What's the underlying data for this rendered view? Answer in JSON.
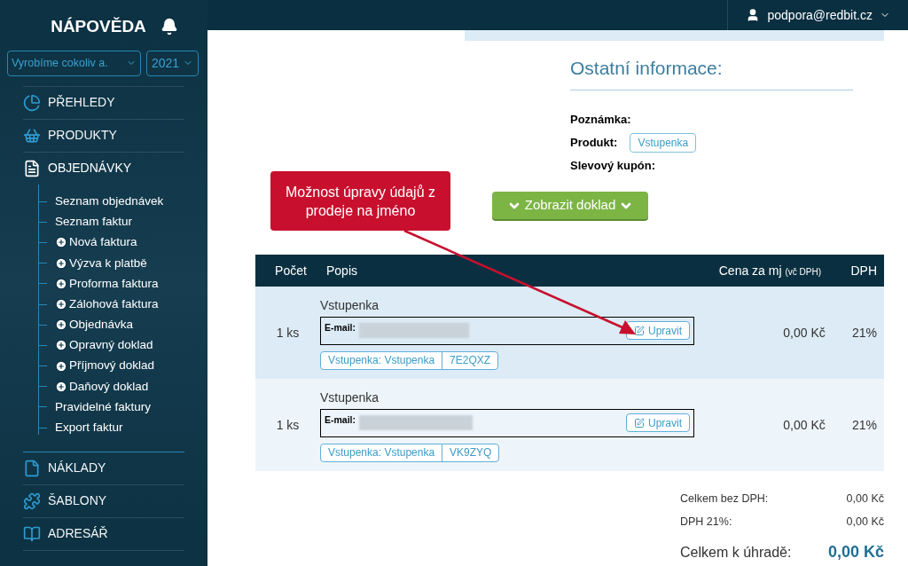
{
  "sidebar": {
    "title": "NÁPOVĚDA",
    "company_select": {
      "value": "Vyrobíme cokoliv a."
    },
    "year_select": {
      "value": "2021"
    },
    "items": [
      {
        "label": "PŘEHLEDY",
        "expanded": false
      },
      {
        "label": "PRODUKTY",
        "expanded": false
      },
      {
        "label": "OBJEDNÁVKY",
        "expanded": true,
        "children": [
          {
            "label": "Seznam objednávek",
            "kind": "link"
          },
          {
            "label": "Seznam faktur",
            "kind": "link"
          },
          {
            "label": "Nová faktura",
            "kind": "create"
          },
          {
            "label": "Výzva k platbě",
            "kind": "create"
          },
          {
            "label": "Proforma faktura",
            "kind": "create"
          },
          {
            "label": "Zálohová faktura",
            "kind": "create"
          },
          {
            "label": "Objednávka",
            "kind": "create"
          },
          {
            "label": "Opravný doklad",
            "kind": "create"
          },
          {
            "label": "Příjmový doklad",
            "kind": "create"
          },
          {
            "label": "Daňový doklad",
            "kind": "create"
          },
          {
            "label": "Pravidelné faktury",
            "kind": "link"
          },
          {
            "label": "Export faktur",
            "kind": "link"
          }
        ]
      },
      {
        "label": "NÁKLADY",
        "expanded": false
      },
      {
        "label": "ŠABLONY",
        "expanded": false
      },
      {
        "label": "ADRESÁŘ",
        "expanded": false
      }
    ]
  },
  "header": {
    "user": "podpora@redbit.cz"
  },
  "other_info": {
    "title": "Ostatní informace:",
    "fields": [
      {
        "label": "Poznámka:"
      },
      {
        "label": "Produkt:",
        "tag": "Vstupenka"
      },
      {
        "label": "Slevový kupón:"
      }
    ]
  },
  "show_document_button": "Zobrazit doklad",
  "callout": "Možnost úpravy údajů z prodeje na jméno",
  "table": {
    "columns": [
      "Počet",
      "Popis",
      "Cena za mj",
      "(vč DPH)",
      "DPH"
    ],
    "rows": [
      {
        "count": "1 ks",
        "name": "Vstupenka",
        "email_label": "E-mail:",
        "edit": "Upravit",
        "ticket": "Vstupenka: Vstupenka",
        "code": "7E2QXZ",
        "price": "0,00 Kč",
        "vat": "21%"
      },
      {
        "count": "1 ks",
        "name": "Vstupenka",
        "email_label": "E-mail:",
        "edit": "Upravit",
        "ticket": "Vstupenka: Vstupenka",
        "code": "VK9ZYQ",
        "price": "0,00 Kč",
        "vat": "21%"
      }
    ]
  },
  "totals": [
    {
      "label": "Celkem bez DPH:",
      "value": "0,00 Kč",
      "kind": "sub"
    },
    {
      "label": "DPH 21%:",
      "value": "0,00 Kč",
      "kind": "sub"
    },
    {
      "label": "Celkem k úhradě:",
      "value": "0,00 Kč",
      "kind": "grand"
    }
  ]
}
